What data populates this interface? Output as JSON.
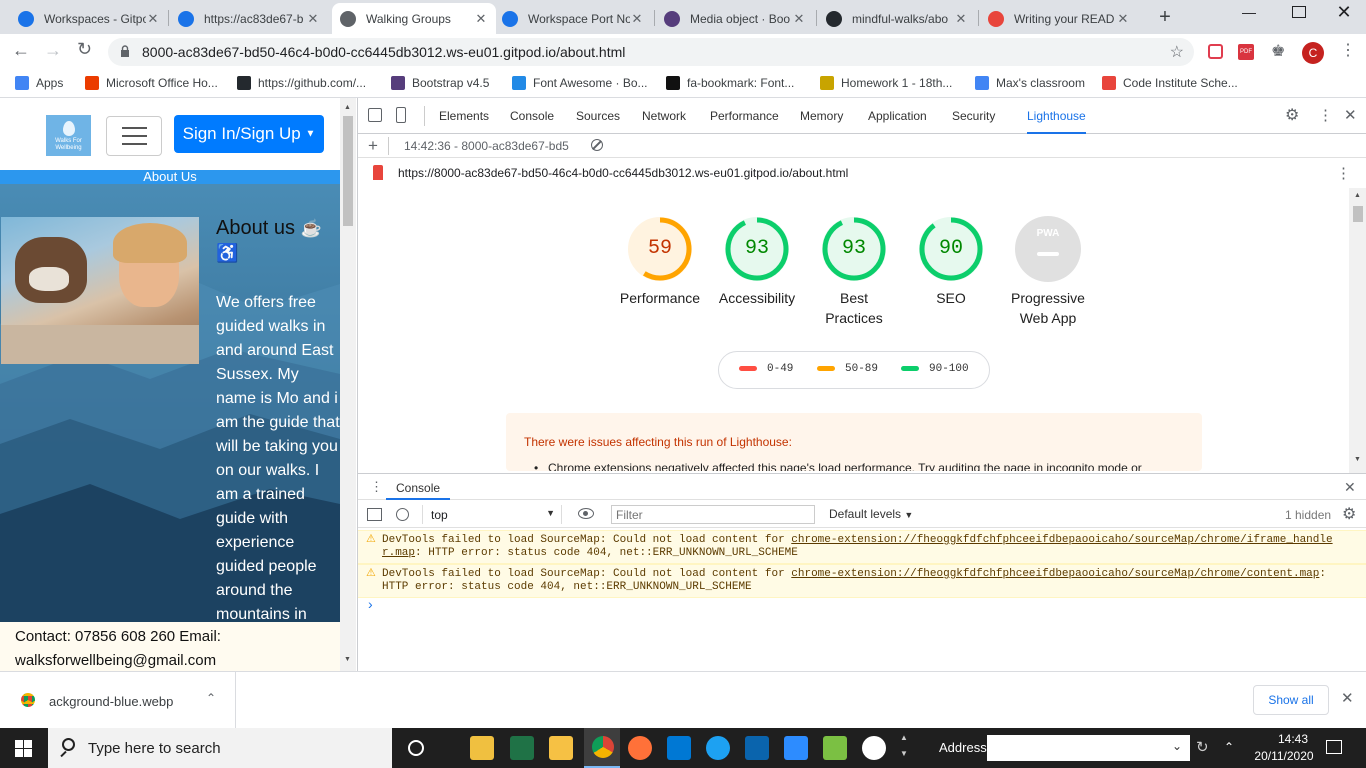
{
  "browser": {
    "tabs": [
      {
        "title": "Workspaces - Gitpod",
        "icon": "gitpod-icon",
        "color": "#1a73e8"
      },
      {
        "title": "https://ac83de67-b",
        "icon": "gitpod-icon",
        "color": "#1a73e8"
      },
      {
        "title": "Walking Groups",
        "icon": "globe-icon",
        "color": "#5f6368",
        "active": true
      },
      {
        "title": "Workspace Port No",
        "icon": "gitpod-icon",
        "color": "#1a73e8"
      },
      {
        "title": "Media object · Boo",
        "icon": "bootstrap-icon",
        "color": "#563d7c"
      },
      {
        "title": "mindful-walks/abo",
        "icon": "github-icon",
        "color": "#24292e"
      },
      {
        "title": "Writing your READ",
        "icon": "codeinstitute-icon",
        "color": "#e8453c"
      }
    ],
    "url": "8000-ac83de67-bd50-46c4-b0d0-cc6445db3012.ws-eu01.gitpod.io/about.html",
    "profile_initial": "C",
    "bookmarks": [
      {
        "label": "Apps",
        "color": "#4285f4"
      },
      {
        "label": "Microsoft Office Ho...",
        "color": "#eb3c00"
      },
      {
        "label": "https://github.com/...",
        "color": "#24292e"
      },
      {
        "label": "Bootstrap v4.5",
        "color": "#563d7c"
      },
      {
        "label": "Font Awesome · Bo...",
        "color": "#228ae6"
      },
      {
        "label": "fa-bookmark: Font...",
        "color": "#111111"
      },
      {
        "label": "Homework 1 - 18th...",
        "color": "#c8a400"
      },
      {
        "label": "Max's classroom",
        "color": "#4285f4"
      },
      {
        "label": "Code Institute Sche...",
        "color": "#e8453c"
      }
    ]
  },
  "site": {
    "logo_text": "Walks For Wellbeing",
    "signin_label": "Sign In/Sign Up",
    "nav_label": "About Us",
    "heading": "About us",
    "body": "We offers free guided walks in and around East Sussex. My name is Mo and i am the guide that will be taking you on our walks. I am a trained guide with experience guided people around the mountains in",
    "footer": "Contact: 07856 608 260 Email: walksforwellbeing@gmail.com"
  },
  "devtools": {
    "tabs": [
      "Elements",
      "Console",
      "Sources",
      "Network",
      "Performance",
      "Memory",
      "Application",
      "Security",
      "Lighthouse"
    ],
    "active_tab": "Lighthouse",
    "report_label": "14:42:36 - 8000-ac83de67-bd5",
    "report_url": "https://8000-ac83de67-bd50-46c4-b0d0-cc6445db3012.ws-eu01.gitpod.io/about.html",
    "scores": [
      {
        "value": "59",
        "label": "Performance",
        "fraction": 0.59,
        "color": "#ffa400",
        "bg": "#fff3e0"
      },
      {
        "value": "93",
        "label": "Accessibility",
        "fraction": 0.93,
        "color": "#0cce6b",
        "bg": "#e6f9ee"
      },
      {
        "value": "93",
        "label": "Best Practices",
        "fraction": 0.93,
        "color": "#0cce6b",
        "bg": "#e6f9ee"
      },
      {
        "value": "90",
        "label": "SEO",
        "fraction": 0.9,
        "color": "#0cce6b",
        "bg": "#e6f9ee"
      }
    ],
    "pwa": {
      "badge": "PWA",
      "label": "Progressive Web App"
    },
    "legend": [
      {
        "range": "0-49",
        "color": "#ff4e42"
      },
      {
        "range": "50-89",
        "color": "#ffa400"
      },
      {
        "range": "90-100",
        "color": "#0cce6b"
      }
    ],
    "warning_title": "There were issues affecting this run of Lighthouse:",
    "warning_item": "Chrome extensions negatively affected this page's load performance. Try auditing the page in incognito mode or",
    "console": {
      "title": "Console",
      "context": "top",
      "filter_placeholder": "Filter",
      "levels": "Default levels",
      "hidden": "1 hidden",
      "messages": [
        {
          "text": "DevTools failed to load SourceMap: Could not load content for ",
          "link": "chrome-extension://fheoggkfdfchfphceeifdbepaooicaho/sourceMap/chrome/iframe_handler.map",
          "tail": ": HTTP error: status code 404, net::ERR_UNKNOWN_URL_SCHEME"
        },
        {
          "text": "DevTools failed to load SourceMap: Could not load content for ",
          "link": "chrome-extension://fheoggkfdfchfphceeifdbepaooicaho/sourceMap/chrome/content.map",
          "tail": ": HTTP error: status code 404, net::ERR_UNKNOWN_URL_SCHEME"
        }
      ],
      "prompt": "›"
    }
  },
  "download": {
    "filename": "ackground-blue.webp",
    "show_all": "Show all"
  },
  "taskbar": {
    "search_placeholder": "Type here to search",
    "address_label": "Address",
    "time": "14:43",
    "date": "20/11/2020"
  }
}
